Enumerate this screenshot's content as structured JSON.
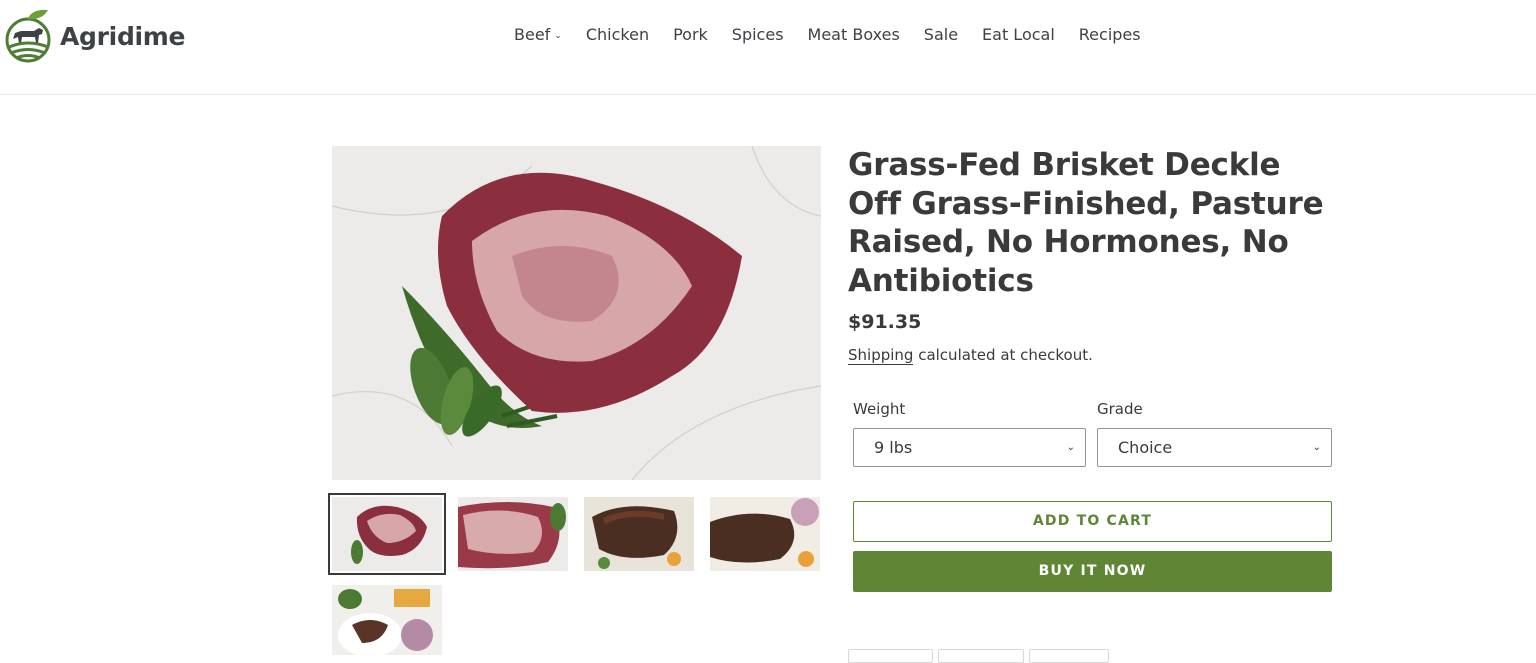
{
  "brand": {
    "name": "Agridime",
    "logo_icon": "cow-farm-logo-icon"
  },
  "nav": {
    "items": [
      {
        "label": "Beef",
        "has_dropdown": true
      },
      {
        "label": "Chicken"
      },
      {
        "label": "Pork"
      },
      {
        "label": "Spices"
      },
      {
        "label": "Meat Boxes"
      },
      {
        "label": "Sale"
      },
      {
        "label": "Eat Local"
      },
      {
        "label": "Recipes"
      }
    ]
  },
  "product": {
    "title": "Grass-Fed Brisket Deckle Off Grass-Finished, Pasture Raised, No Hormones, No Antibiotics",
    "price": "$91.35",
    "shipping_link": "Shipping",
    "shipping_text": " calculated at checkout.",
    "options": {
      "weight": {
        "label": "Weight",
        "value": "9 lbs"
      },
      "grade": {
        "label": "Grade",
        "value": "Choice"
      }
    },
    "add_to_cart": "ADD TO CART",
    "buy_now": "BUY IT NOW"
  },
  "colors": {
    "accent": "#5f8634",
    "text": "#3a3a3a",
    "border": "#949494"
  }
}
